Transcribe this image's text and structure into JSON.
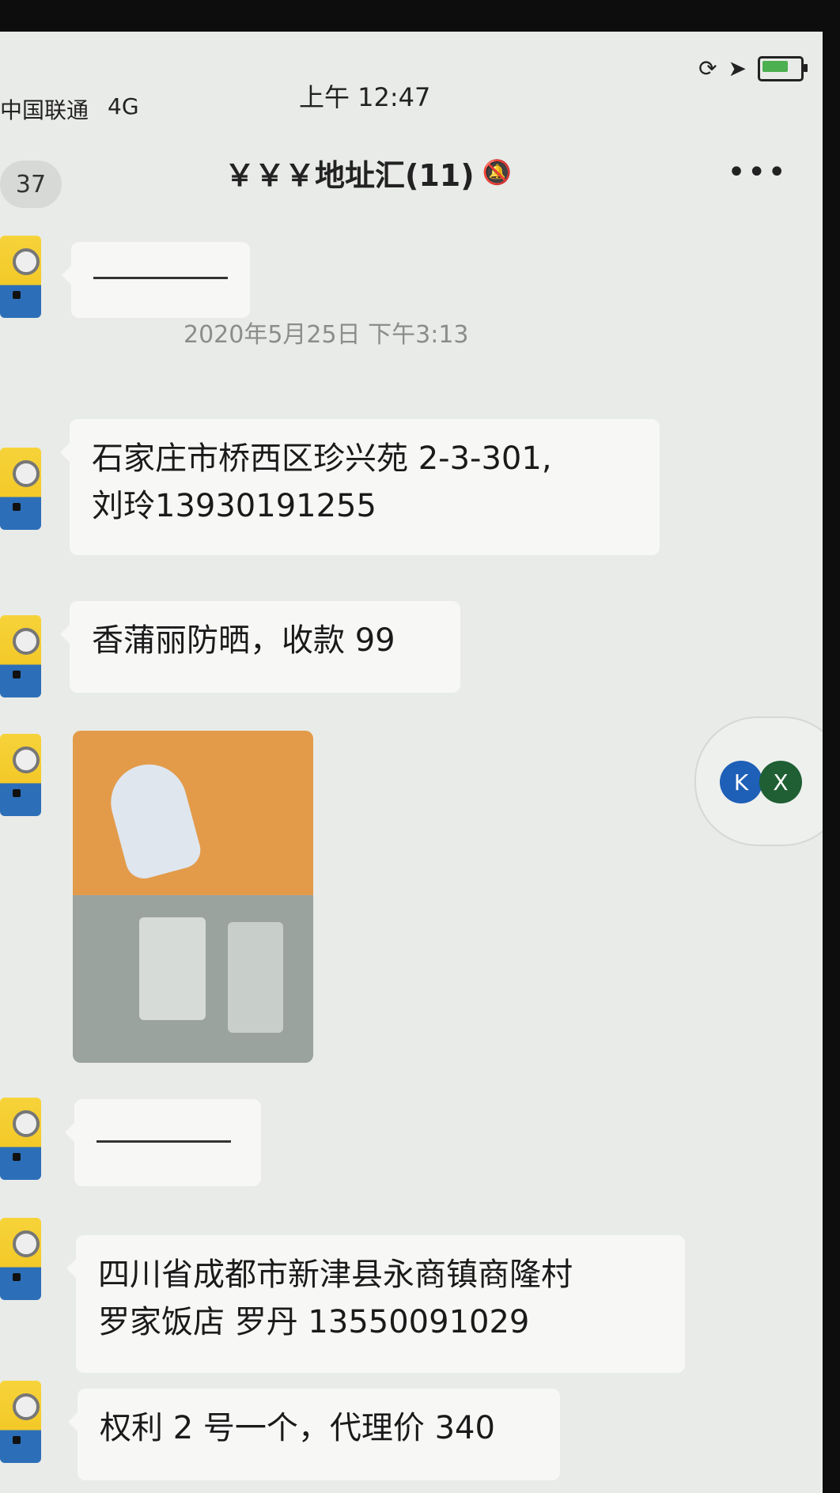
{
  "status_bar": {
    "carrier": "中国联通",
    "network": "4G",
    "time": "上午 12:47",
    "icons": [
      "orientation-lock-icon",
      "location-arrow-icon",
      "battery-charging-icon"
    ]
  },
  "header": {
    "back_badge": "37",
    "title": "￥￥￥地址汇(11)",
    "mute_icon": "mute-bell-icon",
    "more": "•••"
  },
  "messages": {
    "timestamp": "2020年5月25日 下午3:13",
    "msg1": "石家庄市桥西区珍兴苑 2-3-301,\n刘玲13930191255",
    "msg2": "香蒲丽防晒，收款 99",
    "msg3": "四川省成都市新津县永商镇商隆村\n罗家饭店 罗丹 13550091029",
    "msg4": "权利 2 号一个，代理价 340"
  },
  "float_pill": {
    "icon_a": "K",
    "icon_b": "X"
  }
}
